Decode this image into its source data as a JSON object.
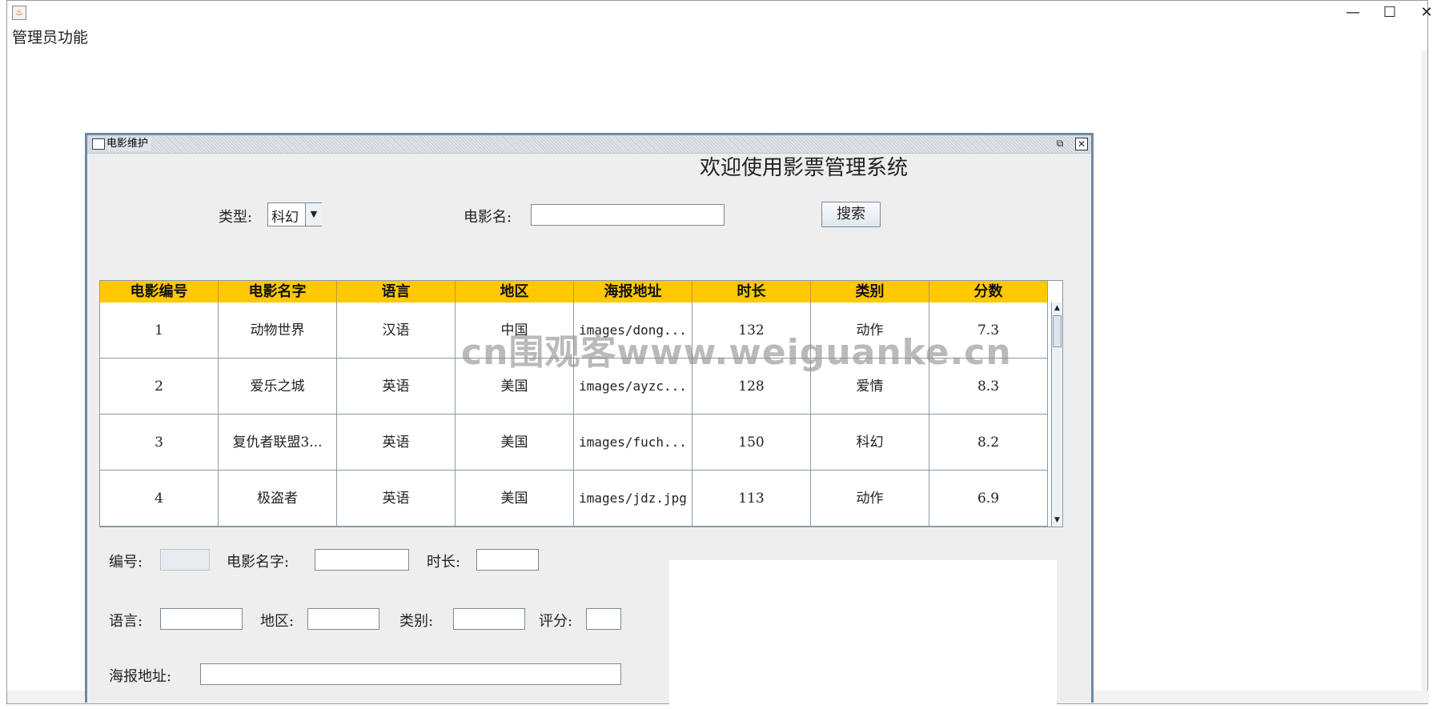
{
  "window": {
    "menu_item": "管理员功能",
    "minimize": "—",
    "maximize": "☐",
    "close": "✕",
    "java_icon": "♨"
  },
  "internal_frame": {
    "title": "电影维护",
    "restore": "⧉",
    "close": "✕",
    "welcome": "欢迎使用影票管理系统"
  },
  "search": {
    "type_label": "类型:",
    "type_value": "科幻",
    "name_label": "电影名:",
    "name_value": "",
    "search_button": "搜索"
  },
  "table": {
    "headers": [
      "电影编号",
      "电影名字",
      "语言",
      "地区",
      "海报地址",
      "时长",
      "类别",
      "分数"
    ],
    "rows": [
      [
        "1",
        "动物世界",
        "汉语",
        "中国",
        "images/dong...",
        "132",
        "动作",
        "7.3"
      ],
      [
        "2",
        "爱乐之城",
        "英语",
        "美国",
        "images/ayzc...",
        "128",
        "爱情",
        "8.3"
      ],
      [
        "3",
        "复仇者联盟3...",
        "英语",
        "美国",
        "images/fuch...",
        "150",
        "科幻",
        "8.2"
      ],
      [
        "4",
        "极盗者",
        "英语",
        "美国",
        "images/jdz.jpg",
        "113",
        "动作",
        "6.9"
      ]
    ],
    "scroll_up": "▲",
    "scroll_down": "▼"
  },
  "form": {
    "id_label": "编号:",
    "name_label": "电影名字:",
    "duration_label": "时长:",
    "language_label": "语言:",
    "region_label": "地区:",
    "category_label": "类别:",
    "score_label": "评分:",
    "poster_label": "海报地址:"
  },
  "watermark": "cn围观客www.weiguanke.cn",
  "icons": {
    "combo_arrow": "▼"
  }
}
